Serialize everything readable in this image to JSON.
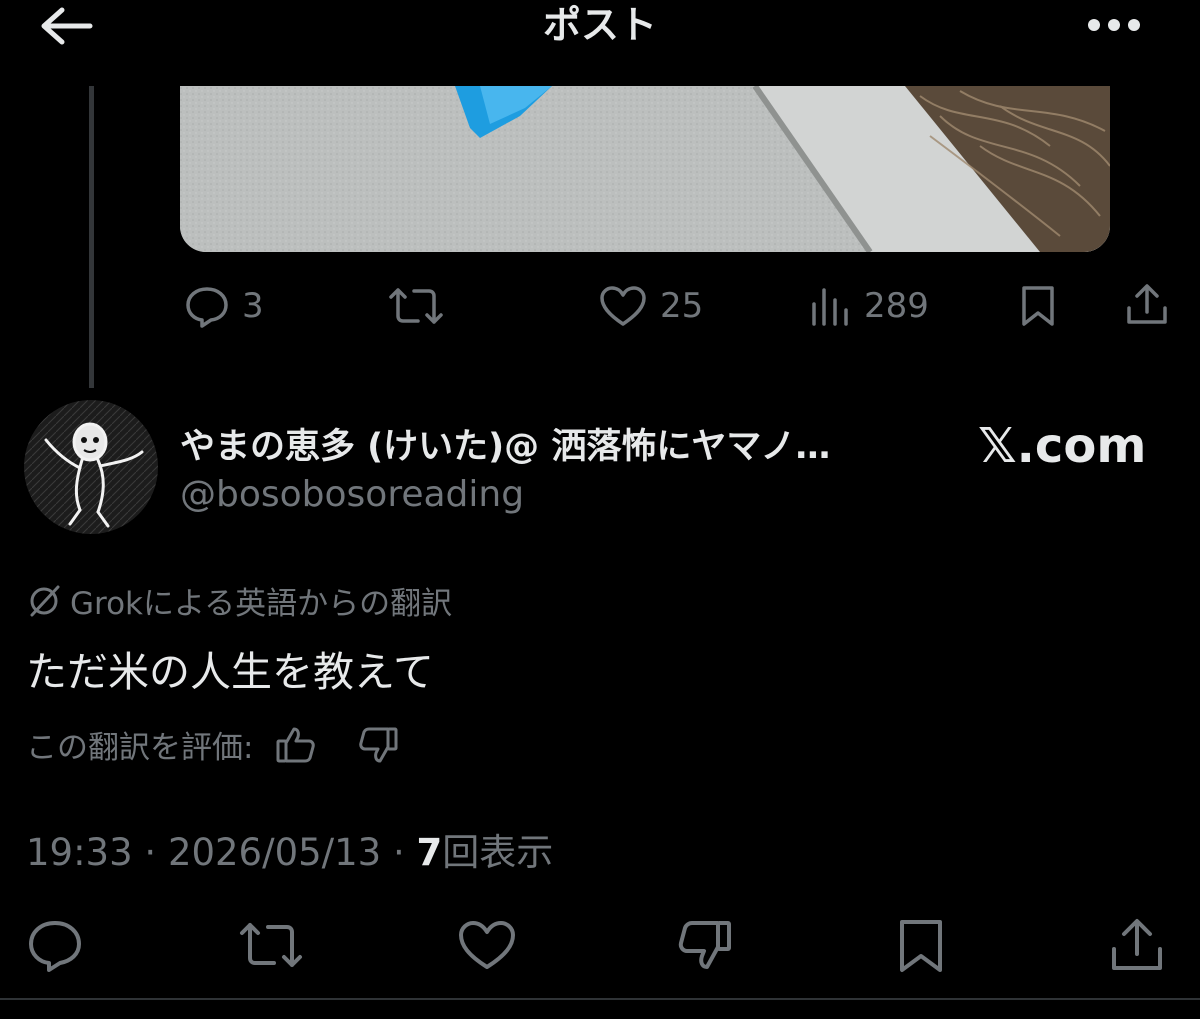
{
  "header": {
    "title": "ポスト",
    "back_icon": "arrow-left-icon",
    "more_icon": "more-dots-icon"
  },
  "quoted_post": {
    "actions": {
      "replies": "3",
      "likes": "25",
      "views": "289"
    }
  },
  "author": {
    "display_name": "やまの恵多 (けいた)@ 洒落怖にヤマノ…",
    "handle": "@bosobosoreading"
  },
  "watermark": "𝕏.com",
  "translation": {
    "label": "Grokによる英語からの翻訳",
    "text": "ただ米の人生を教えて",
    "rate_label": "この翻訳を評価:"
  },
  "meta": {
    "time": "19:33",
    "separator": "·",
    "date": "2026/05/13",
    "views_count": "7",
    "views_label": "回表示"
  },
  "colors": {
    "background": "#000000",
    "text_primary": "#e7e9ea",
    "text_secondary": "#71767b",
    "divider": "#2f3336"
  }
}
